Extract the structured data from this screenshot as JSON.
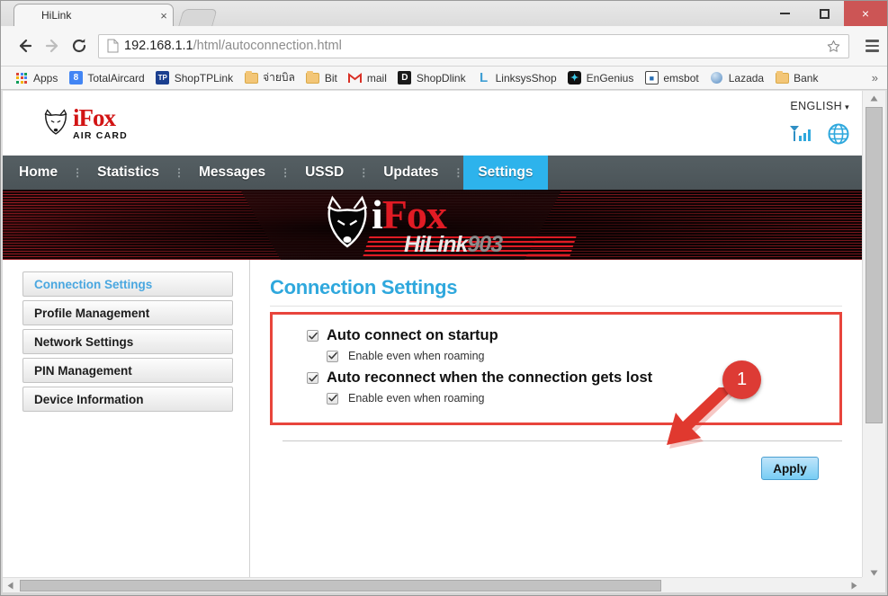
{
  "browser": {
    "tab": {
      "title": "HiLink",
      "close_label": "×"
    },
    "window_controls": {
      "minimize": "minimize-button",
      "maximize": "maximize-button",
      "close": "×"
    },
    "toolbar": {
      "back": "back-button",
      "forward": "forward-button",
      "reload": "reload-button",
      "url_host": "192.168.1.1",
      "url_path": "/html/autoconnection.html",
      "star": "bookmark-star",
      "menu": "chrome-menu"
    },
    "bookmarks": {
      "overflow_label": "»",
      "items": [
        {
          "label": "Apps",
          "icon": "apps-grid-icon"
        },
        {
          "label": "TotalAircard",
          "icon": "google-icon",
          "glyph": "8",
          "color": "#4285f4"
        },
        {
          "label": "ShopTPLink",
          "icon": "tplink-icon",
          "glyph": "TP",
          "color": "#1b3f8f"
        },
        {
          "label": "จ่ายบิล",
          "icon": "folder-icon"
        },
        {
          "label": "Bit",
          "icon": "folder-icon"
        },
        {
          "label": "mail",
          "icon": "gmail-icon",
          "glyph": "M",
          "color": "#d93025"
        },
        {
          "label": "ShopDlink",
          "icon": "dlink-icon",
          "glyph": "D",
          "color": "#1a1a1a"
        },
        {
          "label": "LinksysShop",
          "icon": "linksys-icon",
          "glyph": "L",
          "color": "#3f9fd4"
        },
        {
          "label": "EnGenius",
          "icon": "engenius-icon",
          "glyph": "✦",
          "color": "#111111"
        },
        {
          "label": "emsbot",
          "icon": "robot-icon",
          "glyph": "▣",
          "color": "#ffffff"
        },
        {
          "label": "Lazada",
          "icon": "globe-icon",
          "glyph": "●",
          "color": "#5b8ec4"
        },
        {
          "label": "Bank",
          "icon": "folder-icon"
        }
      ]
    }
  },
  "page": {
    "brand": {
      "logo_i": "i",
      "logo_fox": "Fox",
      "tagline": "AIR CARD",
      "fox_head_icon": "fox-head-icon"
    },
    "language": {
      "value": "ENGLISH",
      "caret": "▾"
    },
    "status_icons": [
      {
        "name": "signal-strength-icon"
      },
      {
        "name": "network-globe-icon"
      }
    ],
    "nav": {
      "separator": "⋮",
      "items": [
        {
          "label": "Home",
          "active": false
        },
        {
          "label": "Statistics",
          "active": false
        },
        {
          "label": "Messages",
          "active": false
        },
        {
          "label": "USSD",
          "active": false
        },
        {
          "label": "Updates",
          "active": false
        },
        {
          "label": "Settings",
          "active": true
        }
      ]
    },
    "banner": {
      "word_i": "i",
      "word_fox": "Fox",
      "sub_hi": "HiLink",
      "sub_num": "903"
    },
    "sidebar": {
      "items": [
        {
          "label": "Connection Settings",
          "active": true
        },
        {
          "label": "Profile Management",
          "active": false
        },
        {
          "label": "Network Settings",
          "active": false
        },
        {
          "label": "PIN Management",
          "active": false
        },
        {
          "label": "Device Information",
          "active": false
        }
      ]
    },
    "main": {
      "title": "Connection Settings",
      "options": [
        {
          "label": "Auto connect on startup",
          "checked": true,
          "sub": false
        },
        {
          "label": "Enable even when roaming",
          "checked": true,
          "sub": true
        },
        {
          "label": "Auto reconnect when the connection gets lost",
          "checked": true,
          "sub": false
        },
        {
          "label": "Enable even when roaming",
          "checked": true,
          "sub": true
        }
      ],
      "apply_label": "Apply"
    },
    "annotation": {
      "badge_number": "1",
      "arrow": "red-arrow-annotation"
    }
  },
  "colors": {
    "accent_blue": "#2fa8dd",
    "nav_active": "#2db3ec",
    "nav_bg": "#4f585c",
    "highlight_red": "#e8453c",
    "badge_red": "#dd3b35",
    "brand_red": "#d21414"
  }
}
